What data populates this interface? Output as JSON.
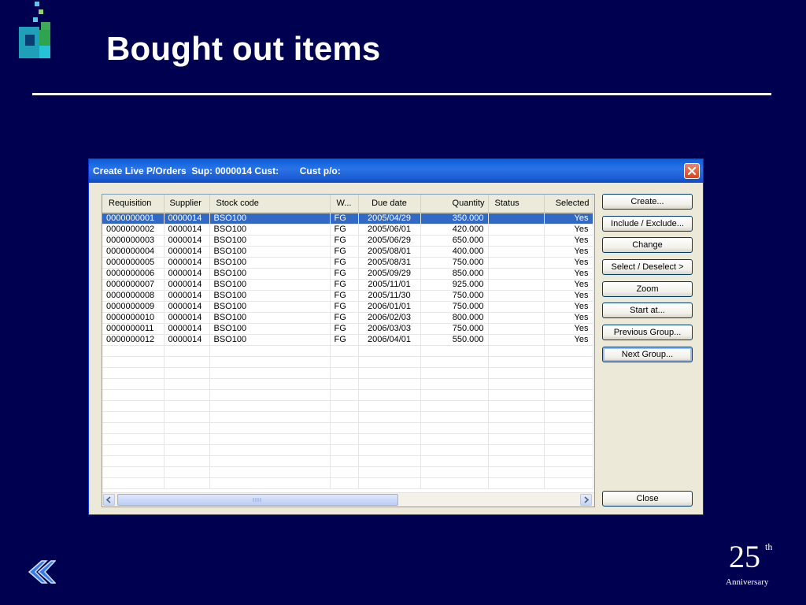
{
  "slide": {
    "title": "Bought out items",
    "logo_icon": "pixel-cube-logo-icon",
    "back_icon": "double-chevron-left-icon",
    "anniversary": {
      "number": "25",
      "suffix": "th",
      "word": "Anniversary"
    }
  },
  "window": {
    "title": "Create Live P/Orders  Sup: 0000014 Cust:        Cust p/o:",
    "close_icon": "close-icon"
  },
  "table": {
    "columns": [
      "Requisition",
      "Supplier",
      "Stock code",
      "W...",
      "Due date",
      "Quantity",
      "Status",
      "Selected"
    ],
    "rows": [
      [
        "0000000001",
        "0000014",
        "BSO100",
        "FG",
        "2005/04/29",
        "350.000",
        "",
        "Yes"
      ],
      [
        "0000000002",
        "0000014",
        "BSO100",
        "FG",
        "2005/06/01",
        "420.000",
        "",
        "Yes"
      ],
      [
        "0000000003",
        "0000014",
        "BSO100",
        "FG",
        "2005/06/29",
        "650.000",
        "",
        "Yes"
      ],
      [
        "0000000004",
        "0000014",
        "BSO100",
        "FG",
        "2005/08/01",
        "400.000",
        "",
        "Yes"
      ],
      [
        "0000000005",
        "0000014",
        "BSO100",
        "FG",
        "2005/08/31",
        "750.000",
        "",
        "Yes"
      ],
      [
        "0000000006",
        "0000014",
        "BSO100",
        "FG",
        "2005/09/29",
        "850.000",
        "",
        "Yes"
      ],
      [
        "0000000007",
        "0000014",
        "BSO100",
        "FG",
        "2005/11/01",
        "925.000",
        "",
        "Yes"
      ],
      [
        "0000000008",
        "0000014",
        "BSO100",
        "FG",
        "2005/11/30",
        "750.000",
        "",
        "Yes"
      ],
      [
        "0000000009",
        "0000014",
        "BSO100",
        "FG",
        "2006/01/01",
        "750.000",
        "",
        "Yes"
      ],
      [
        "0000000010",
        "0000014",
        "BSO100",
        "FG",
        "2006/02/03",
        "800.000",
        "",
        "Yes"
      ],
      [
        "0000000011",
        "0000014",
        "BSO100",
        "FG",
        "2006/03/03",
        "750.000",
        "",
        "Yes"
      ],
      [
        "0000000012",
        "0000014",
        "BSO100",
        "FG",
        "2006/04/01",
        "550.000",
        "",
        "Yes"
      ]
    ],
    "selected_row": 0,
    "empty_rows": 13,
    "selection_color": "#316ac5"
  },
  "buttons": {
    "create": "Create...",
    "include_exclude": "Include / Exclude...",
    "change": "Change",
    "select_deselect": "Select / Deselect >",
    "zoom": "Zoom",
    "start_at": "Start at...",
    "previous_group": "Previous Group...",
    "next_group": "Next Group...",
    "close": "Close"
  },
  "colors": {
    "background": "#000050",
    "titlebar": "#0a5fd8"
  }
}
